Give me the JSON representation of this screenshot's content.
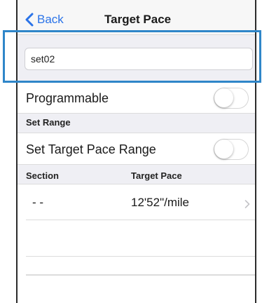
{
  "navbar": {
    "back_label": "Back",
    "title": "Target Pace"
  },
  "name_field": {
    "value": "set02"
  },
  "programmable": {
    "label": "Programmable",
    "on": false
  },
  "set_range_section": {
    "header": "Set Range",
    "toggle_label": "Set Target Pace Range",
    "on": false
  },
  "table": {
    "columns": [
      "Section",
      "Target Pace"
    ],
    "rows": [
      {
        "section": "- -",
        "pace": "12'52\"/mile"
      }
    ]
  },
  "colors": {
    "accent": "#2a73e8",
    "highlight": "#2f86c9",
    "grouped_bg": "#efeff4"
  }
}
